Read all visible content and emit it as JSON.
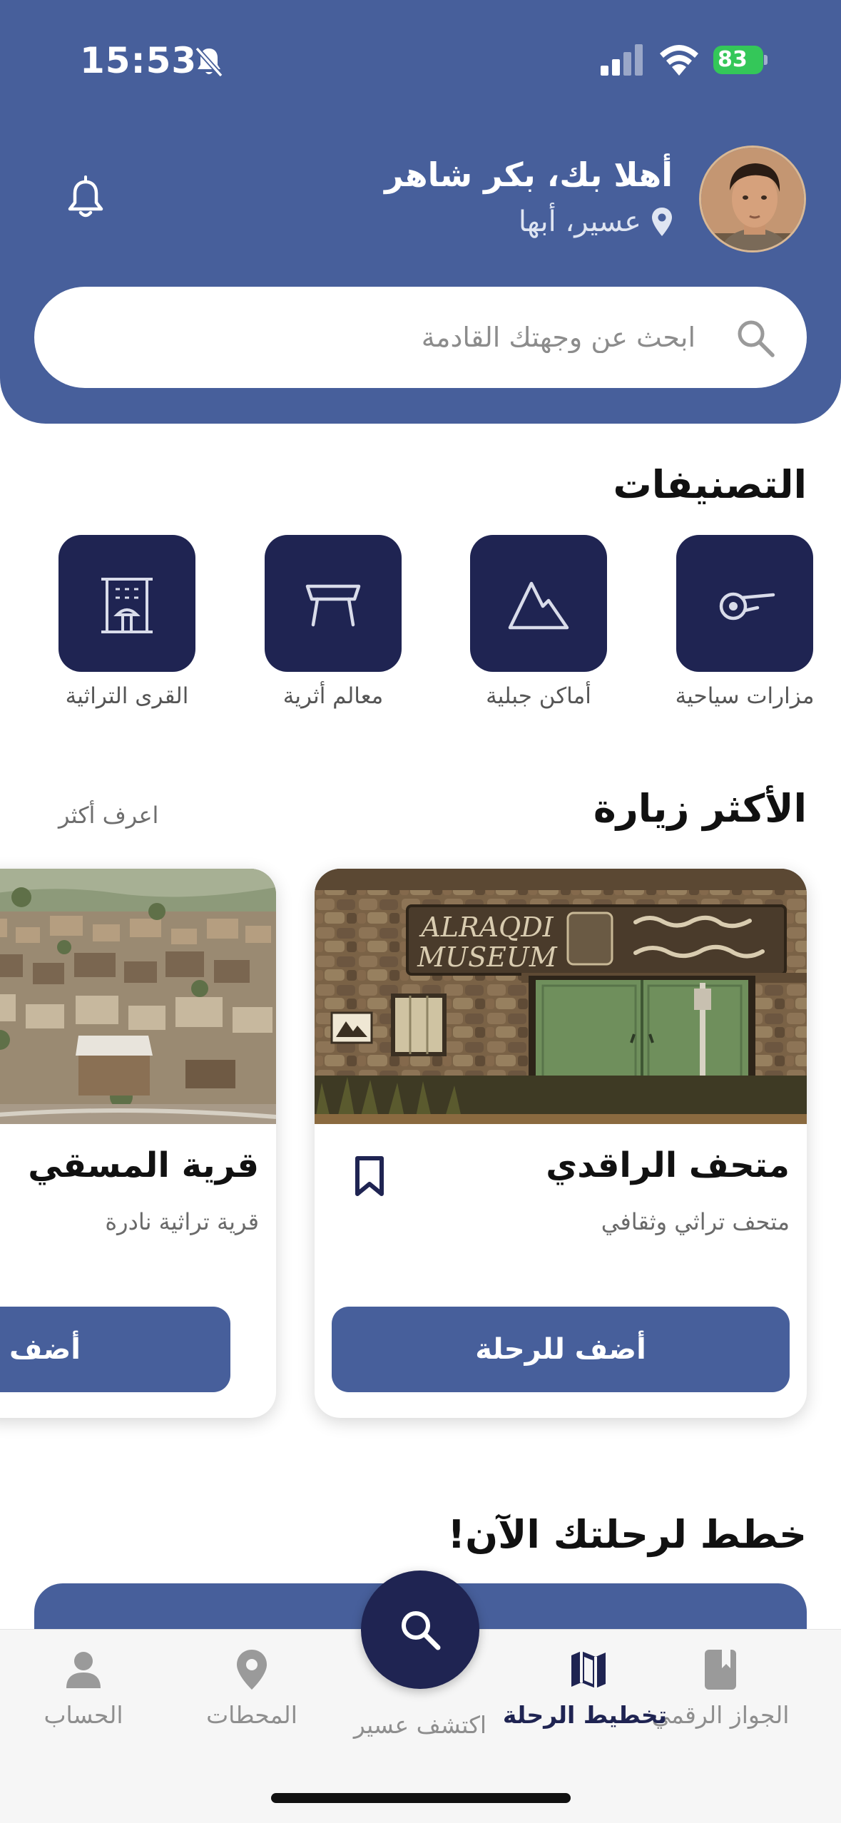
{
  "status_bar": {
    "time": "15:53",
    "battery": "83"
  },
  "header": {
    "greeting": "أهلا بك، بكر شاهر",
    "location": "عسير، أبها"
  },
  "search": {
    "placeholder": "ابحث عن وجهتك القادمة"
  },
  "categories": {
    "title": "التصنيفات",
    "items": [
      {
        "label": "مزارات سياحية",
        "icon": "tourist-spots-icon"
      },
      {
        "label": "أماكن جبلية",
        "icon": "mountain-icon"
      },
      {
        "label": "معالم أثرية",
        "icon": "landmark-icon"
      },
      {
        "label": "القرى التراثية",
        "icon": "heritage-village-icon"
      }
    ]
  },
  "most_visited": {
    "title": "الأكثر زيارة",
    "more": "اعرف أكثر",
    "cards": [
      {
        "name": "متحف الراقدي",
        "subtitle": "متحف تراثي وثقافي",
        "button": "أضف للرحلة",
        "sign_text_1": "ALRAQDI",
        "sign_text_2": "MUSEUM"
      },
      {
        "name": "قرية المسقي",
        "subtitle": "قرية تراثية نادرة",
        "button": "أضف للرحلة"
      }
    ]
  },
  "plan": {
    "title": "خطط لرحلتك الآن!"
  },
  "tabbar": {
    "items": [
      {
        "label": "الجواز الرقمي",
        "icon": "passport-icon"
      },
      {
        "label": "تخطيط الرحلة",
        "icon": "map-icon",
        "active": true
      },
      {
        "label": "اكتشف عسير",
        "icon": "search-icon"
      },
      {
        "label": "المحطات",
        "icon": "location-pin-icon"
      },
      {
        "label": "الحساب",
        "icon": "person-icon"
      }
    ]
  },
  "colors": {
    "primary": "#475f9b",
    "dark": "#1f2452",
    "battery": "#34c759"
  }
}
